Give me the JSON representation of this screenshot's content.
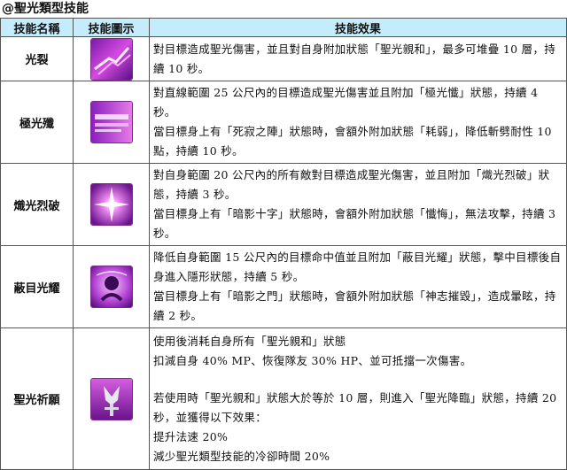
{
  "section_title": "@聖光類型技能",
  "headers": {
    "name": "技能名稱",
    "icon": "技能圖示",
    "effect": "技能效果"
  },
  "rows": [
    {
      "name": "光裂",
      "icon": "light-rift-icon",
      "effect": [
        "對目標造成聖光傷害，並且對自身附加狀態「聖光親和」，最多可堆疊 10 層，持續 10 秒。"
      ]
    },
    {
      "name": "極光殲",
      "icon": "aurora-blast-icon",
      "effect": [
        "對直線範圍 25 公尺內的目標造成聖光傷害並且附加「極光懺」狀態，持續 4 秒。",
        "當目標身上有「死寂之陣」狀態時，會額外附加狀態「耗弱」，降低斬劈耐性 10 點，持續 10 秒。"
      ]
    },
    {
      "name": "熾光烈破",
      "icon": "blazing-burst-icon",
      "effect": [
        "對自身範圍 20 公尺內的所有敵對目標造成聖光傷害，並且附加「熾光烈破」狀態，持續 3 秒。",
        "當目標身上有「暗影十字」狀態時，會額外附加狀態「懺悔」，無法攻擊，持續 3 秒。"
      ]
    },
    {
      "name": "蔽目光耀",
      "icon": "blinding-radiance-icon",
      "effect": [
        "降低自身範圍 15 公尺內的目標命中值並且附加「蔽目光耀」狀態，擊中目標後自身進入隱形狀態，持續 5 秒。",
        "當目標身上有「暗影之門」狀態時，會額外附加狀態「神志摧毀」，造成暈眩，持續 2 秒。"
      ]
    },
    {
      "name": "聖光祈願",
      "icon": "holy-prayer-icon",
      "effect": [
        "使用後消耗自身所有「聖光親和」狀態",
        "扣減自身 40% MP、恢復隊友 30% HP、並可抵擋一次傷害。",
        "",
        "若使用時「聖光親和」狀態大於等於 10 層，則進入「聖光降臨」狀態，持續 20 秒，並獲得以下效果：",
        "提升法速 20%",
        "減少聖光類型技能的冷卻時間 20%"
      ]
    }
  ],
  "colors": {
    "header_bg": "#c5ecfb",
    "icon_purple": "#9b2fc8",
    "icon_magenta": "#e24bd9"
  }
}
